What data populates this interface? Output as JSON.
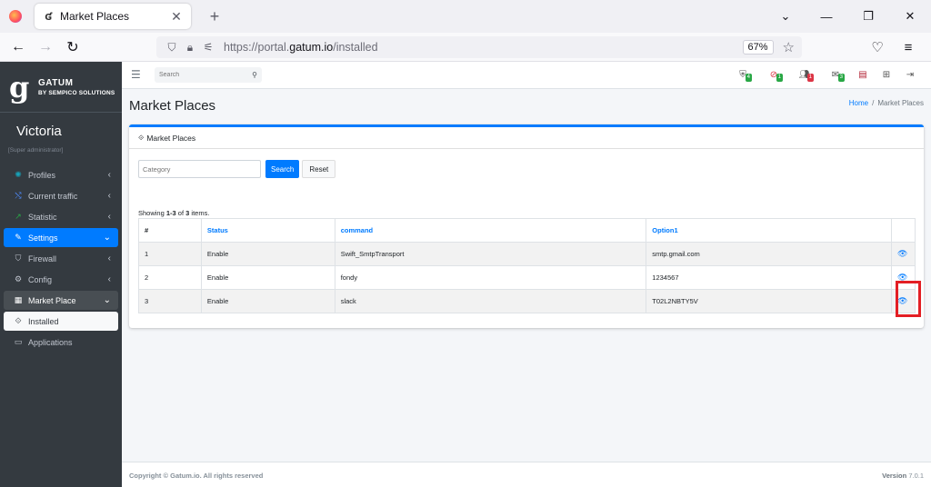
{
  "browser": {
    "tab_title": "Market Places",
    "url_prefix": "https://portal.",
    "url_domain": "gatum.io",
    "url_path": "/installed",
    "zoom": "67%"
  },
  "brand": {
    "name": "GATUM",
    "tagline": "BY SEMPICO SOLUTIONS"
  },
  "user": {
    "name": "Victoria",
    "role": "[Super administrator]"
  },
  "sidebar": {
    "items": [
      {
        "label": "Profiles",
        "icon": "gear-icon"
      },
      {
        "label": "Current traffic",
        "icon": "traffic-icon"
      },
      {
        "label": "Statistic",
        "icon": "chart-icon"
      },
      {
        "label": "Settings",
        "icon": "wrench-icon"
      },
      {
        "label": "Firewall",
        "icon": "shield-icon"
      },
      {
        "label": "Config",
        "icon": "cog-icon"
      },
      {
        "label": "Market Place",
        "icon": "grid-icon"
      },
      {
        "label": "Installed",
        "icon": "code-icon"
      },
      {
        "label": "Applications",
        "icon": "apps-icon"
      }
    ]
  },
  "topbar": {
    "search_placeholder": "Search",
    "badges": [
      "4",
      "1",
      "1",
      "3"
    ]
  },
  "page": {
    "title": "Market Places",
    "breadcrumb_home": "Home",
    "breadcrumb_current": "Market Places"
  },
  "card": {
    "title": "Market Places",
    "filter_placeholder": "Category",
    "search_label": "Search",
    "reset_label": "Reset",
    "summary_prefix": "Showing ",
    "summary_range": "1-3",
    "summary_of": " of ",
    "summary_total": "3",
    "summary_suffix": " items."
  },
  "table": {
    "headers": [
      "#",
      "Status",
      "command",
      "Option1"
    ],
    "rows": [
      {
        "num": "1",
        "status": "Enable",
        "command": "Swift_SmtpTransport",
        "option1": "smtp.gmail.com"
      },
      {
        "num": "2",
        "status": "Enable",
        "command": "fondy",
        "option1": "1234567"
      },
      {
        "num": "3",
        "status": "Enable",
        "command": "slack",
        "option1": "T02L2NBTY5V"
      }
    ]
  },
  "footer": {
    "copyright": "Copyright © Gatum.io. All rights reserved",
    "version_label": "Version",
    "version": "7.0.1"
  },
  "colors": {
    "primary": "#007bff",
    "sidebar": "#343a40",
    "highlight": "#e31e24"
  }
}
